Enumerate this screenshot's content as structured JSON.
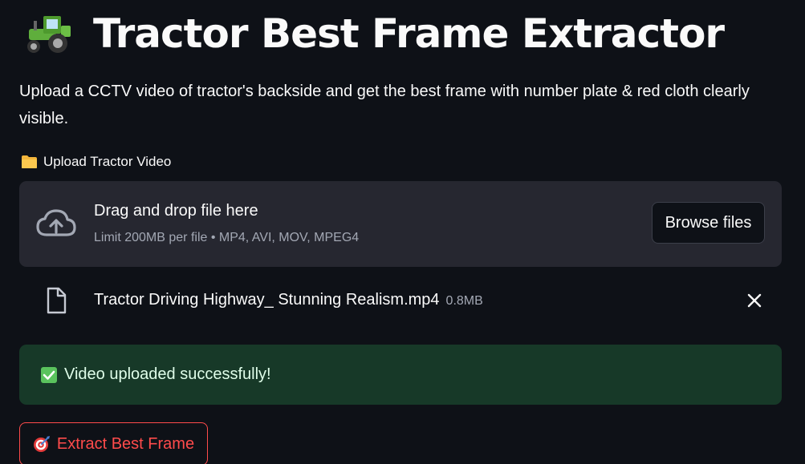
{
  "header": {
    "icon": "tractor-icon",
    "title": "Tractor Best Frame Extractor"
  },
  "description": "Upload a CCTV video of tractor's backside and get the best frame with number plate & red cloth clearly visible.",
  "uploader": {
    "label_icon": "folder-icon",
    "label": "Upload Tractor Video",
    "drop_title": "Drag and drop file here",
    "drop_limit": "Limit 200MB per file • MP4, AVI, MOV, MPEG4",
    "browse_label": "Browse files",
    "icon": "cloud-upload-icon"
  },
  "uploaded_file": {
    "icon": "file-icon",
    "name": "Tractor Driving Highway_ Stunning Realism.mp4",
    "size": "0.8MB",
    "remove_icon": "close-icon"
  },
  "success": {
    "icon": "check-icon",
    "message": "Video uploaded successfully!"
  },
  "extract_button": {
    "icon": "target-icon",
    "label": "Extract Best Frame"
  },
  "colors": {
    "background": "#0e1117",
    "panel": "#262730",
    "success_bg": "#173928",
    "accent": "#ff4b4b"
  }
}
